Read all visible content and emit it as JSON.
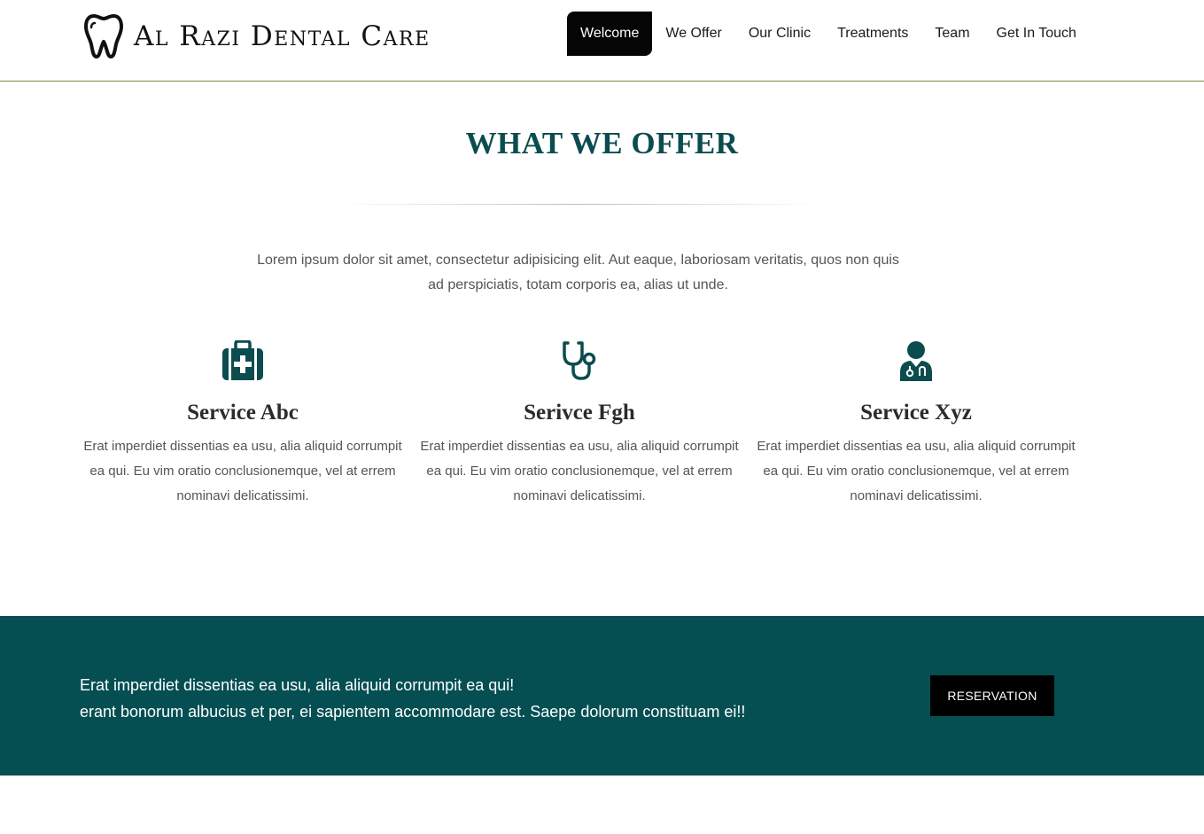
{
  "brand": {
    "name": "Al Razi Dental Care",
    "logo_icon": "tooth-icon"
  },
  "nav": {
    "items": [
      {
        "label": "Welcome",
        "active": true
      },
      {
        "label": "We Offer",
        "active": false
      },
      {
        "label": "Our Clinic",
        "active": false
      },
      {
        "label": "Treatments",
        "active": false
      },
      {
        "label": "Team",
        "active": false
      },
      {
        "label": "Get In Touch",
        "active": false
      }
    ]
  },
  "offer": {
    "title": "WHAT WE OFFER",
    "intro": "Lorem ipsum dolor sit amet, consectetur adipisicing elit. Aut eaque, laboriosam veritatis, quos non quis ad perspiciatis, totam corporis ea, alias ut unde.",
    "services": [
      {
        "icon": "medkit-icon",
        "title": "Service Abc",
        "text": "Erat imperdiet dissentias ea usu, alia aliquid corrumpit ea qui. Eu vim oratio conclusionemque, vel at errem nominavi delicatissimi."
      },
      {
        "icon": "stethoscope-icon",
        "title": "Serivce Fgh",
        "text": "Erat imperdiet dissentias ea usu, alia aliquid corrumpit ea qui. Eu vim oratio conclusionemque, vel at errem nominavi delicatissimi."
      },
      {
        "icon": "doctor-icon",
        "title": "Service Xyz",
        "text": "Erat imperdiet dissentias ea usu, alia aliquid corrumpit ea qui. Eu vim oratio conclusionemque, vel at errem nominavi delicatissimi."
      }
    ]
  },
  "banner": {
    "line1": "Erat imperdiet dissentias ea usu, alia aliquid corrumpit ea qui!",
    "line2": "erant bonorum albucius et per, ei sapientem accommodare est. Saepe dolorum constituam ei!!",
    "button_label": "RESERVATION"
  },
  "colors": {
    "accent": "#0b4c4f",
    "banner_bg": "#054f53",
    "nav_active_bg": "#050505",
    "header_border": "#8a8340"
  }
}
